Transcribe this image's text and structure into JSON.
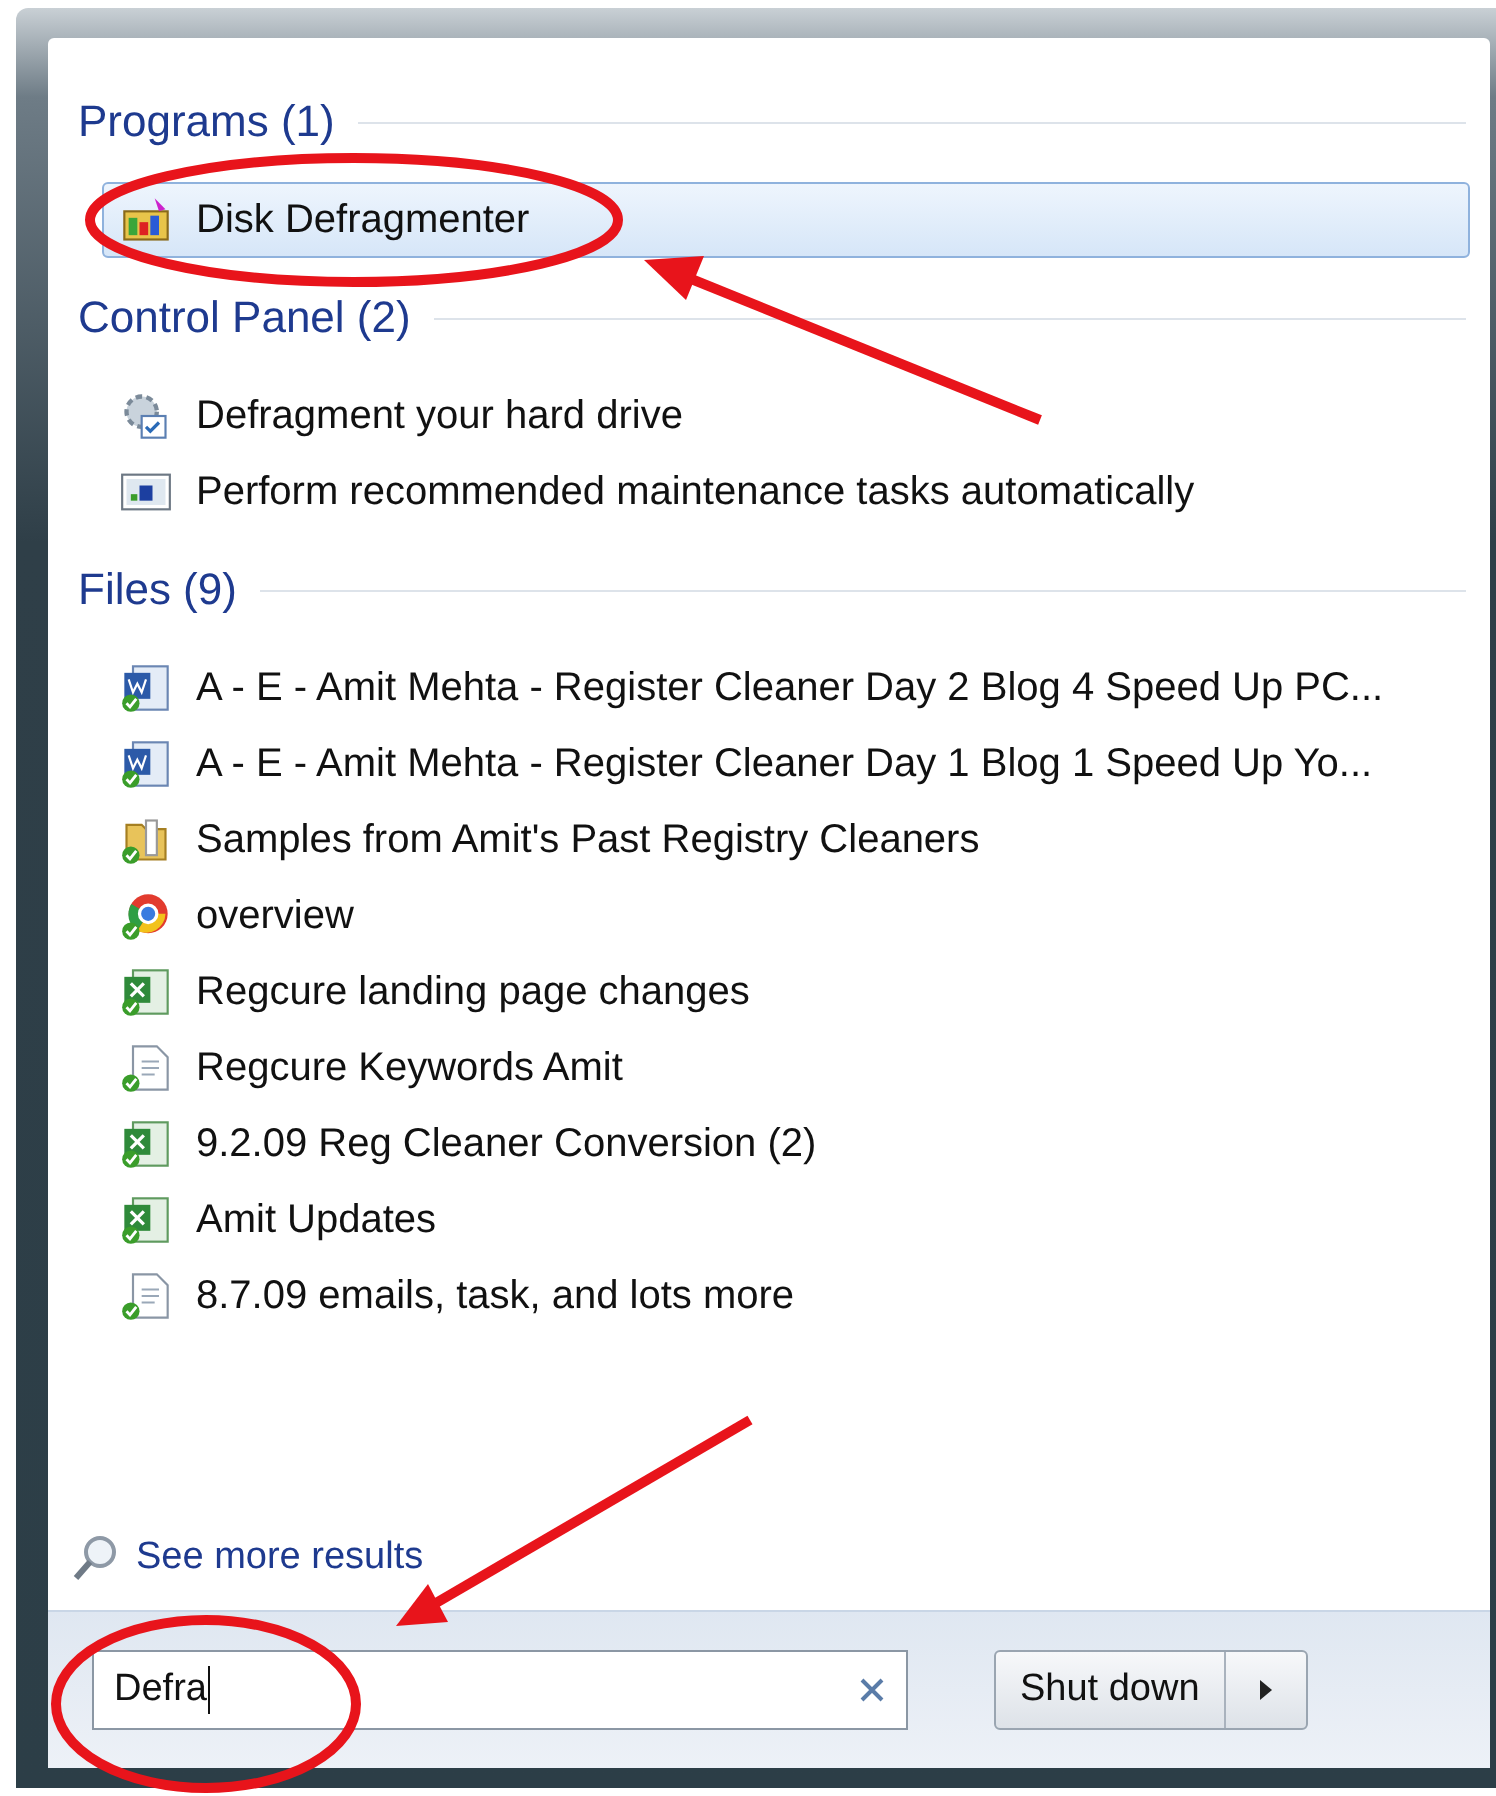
{
  "sections": [
    {
      "header": "Programs (1)",
      "items": [
        {
          "kind": "defrag",
          "label": "Disk Defragmenter",
          "selected": true
        }
      ]
    },
    {
      "header": "Control Panel (2)",
      "items": [
        {
          "kind": "gear",
          "label": "Defragment your hard drive",
          "selected": false
        },
        {
          "kind": "monitor",
          "label": "Perform recommended maintenance tasks automatically",
          "selected": false
        }
      ]
    },
    {
      "header": "Files (9)",
      "items": [
        {
          "kind": "document",
          "label": "A - E - Amit Mehta - Register Cleaner Day 2 Blog 4 Speed Up PC...",
          "selected": false
        },
        {
          "kind": "document",
          "label": "A - E - Amit Mehta - Register Cleaner Day 1 Blog 1 Speed Up Yo...",
          "selected": false
        },
        {
          "kind": "folder",
          "label": "Samples from Amit's Past Registry Cleaners",
          "selected": false
        },
        {
          "kind": "browser",
          "label": "overview",
          "selected": false
        },
        {
          "kind": "spreadsheet",
          "label": "Regcure landing page changes",
          "selected": false
        },
        {
          "kind": "text",
          "label": "Regcure Keywords Amit",
          "selected": false
        },
        {
          "kind": "spreadsheet",
          "label": "9.2.09 Reg Cleaner Conversion (2)",
          "selected": false
        },
        {
          "kind": "spreadsheet",
          "label": "Amit Updates",
          "selected": false
        },
        {
          "kind": "text",
          "label": "8.7.09 emails, task, and lots more",
          "selected": false
        }
      ]
    }
  ],
  "see_more": "See more results",
  "search": {
    "value": "Defra"
  },
  "shutdown": {
    "label": "Shut down"
  },
  "annotations": [
    {
      "kind": "ellipse"
    },
    {
      "kind": "arrow"
    },
    {
      "kind": "ellipse"
    },
    {
      "kind": "arrow"
    }
  ]
}
